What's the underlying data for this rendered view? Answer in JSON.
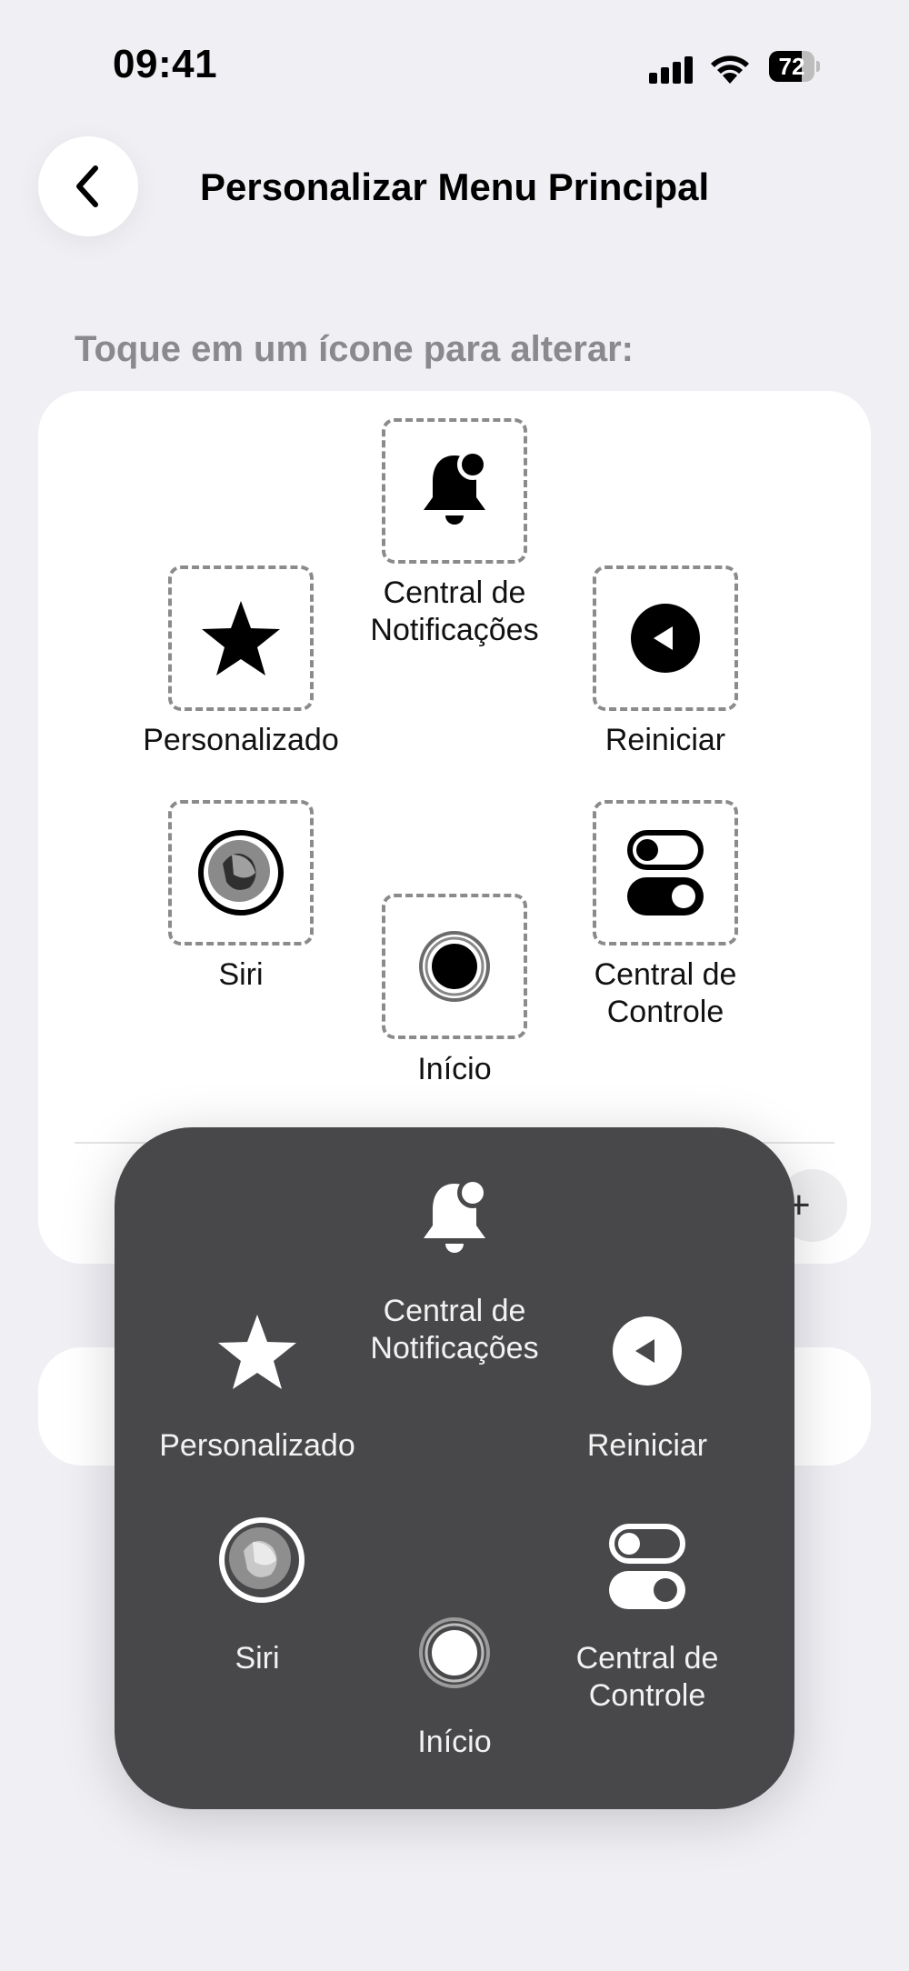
{
  "status_bar": {
    "time": "09:41",
    "battery": "72",
    "battery_level_percent": 72,
    "icons": [
      "cellular-signal-icon",
      "wifi-icon",
      "battery-icon"
    ]
  },
  "header": {
    "back_icon": "chevron-left-icon",
    "title": "Personalizar Menu Principal"
  },
  "instruction": "Toque em um ícone para alterar:",
  "menu_items": {
    "notifications": {
      "label": "Central de Notificações",
      "line1": "Central de",
      "line2": "Notificações",
      "icon": "bell-badge-icon"
    },
    "custom": {
      "label": "Personalizado",
      "icon": "star-icon"
    },
    "restart": {
      "label": "Reiniciar",
      "icon": "restart-icon"
    },
    "siri": {
      "label": "Siri",
      "icon": "siri-icon"
    },
    "home": {
      "label": "Início",
      "icon": "home-button-icon"
    },
    "control_center": {
      "label": "Central de Controle",
      "line1": "Central de",
      "line2": "Controle",
      "icon": "toggles-icon"
    }
  },
  "stepper": {
    "plus": "+"
  },
  "colors": {
    "background": "#F0EFF4",
    "card": "#FFFFFF",
    "overlay": "#48484A",
    "dashed_border": "#8B8B8E",
    "secondary_text": "#8A8A8E"
  }
}
